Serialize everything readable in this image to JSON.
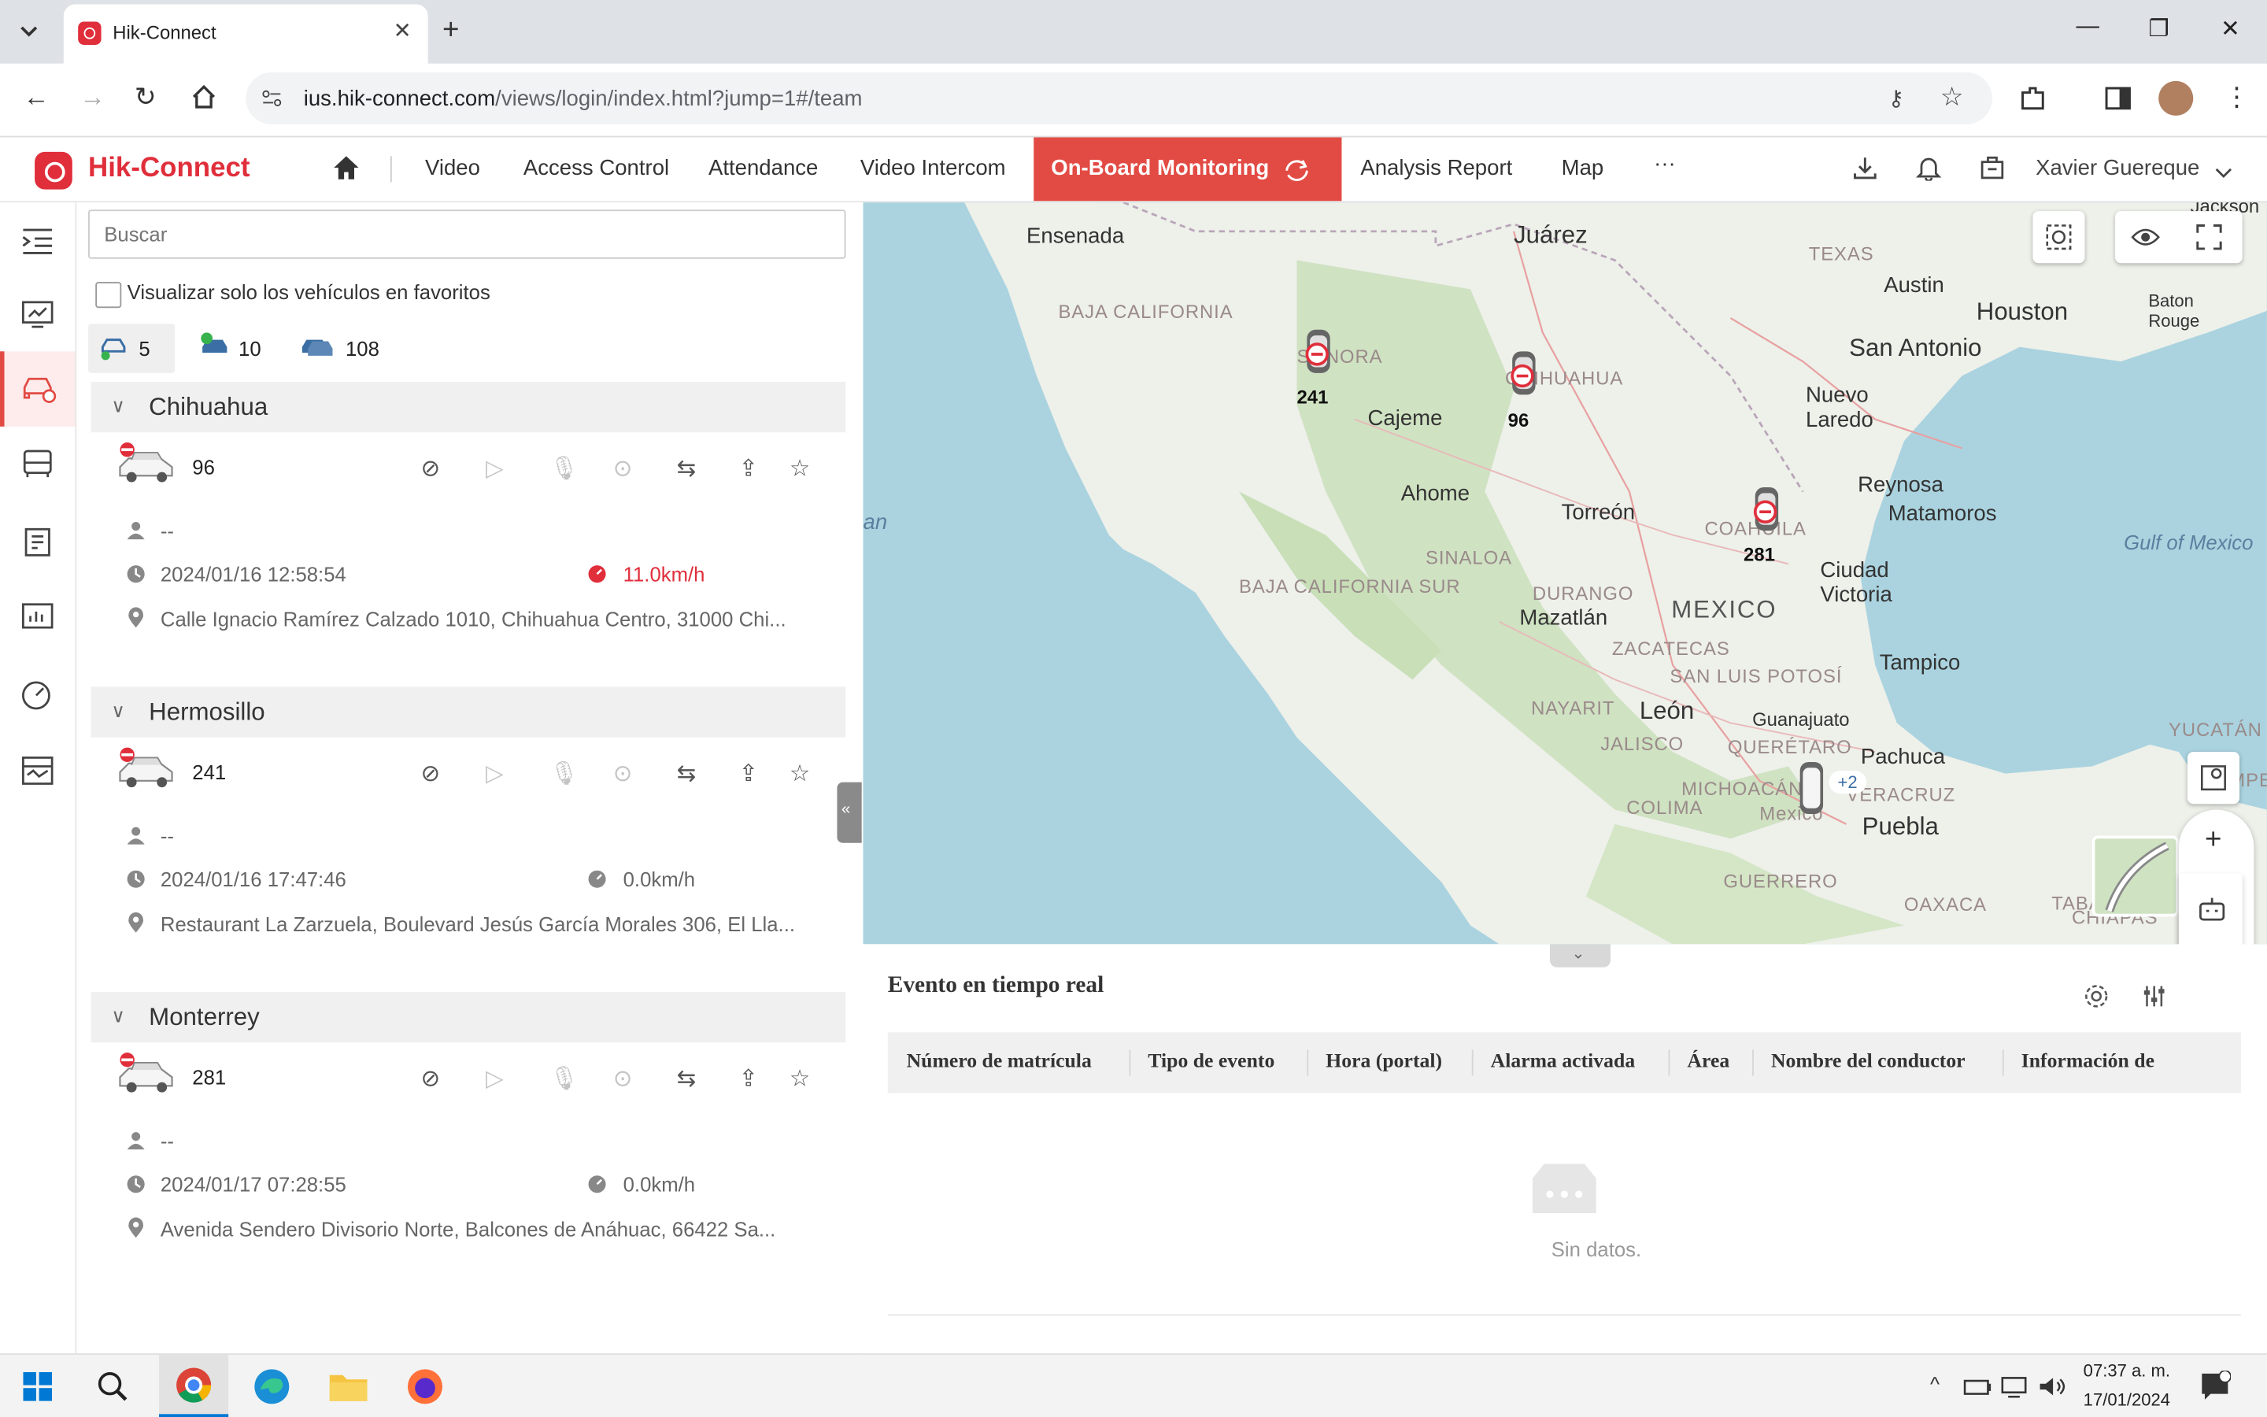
{
  "browser": {
    "tab_title": "Hik-Connect",
    "url_host": "ius.hik-connect.com",
    "url_path": "/views/login/index.html?jump=1#/team"
  },
  "app": {
    "brand": "Hik-Connect",
    "nav": [
      "Video",
      "Access Control",
      "Attendance",
      "Video Intercom",
      "On-Board Monitoring",
      "Analysis Report",
      "Map",
      "···"
    ],
    "user": "Xavier Guereque"
  },
  "panel": {
    "search_placeholder": "Buscar",
    "favorites_label": "Visualizar solo los vehículos en favoritos",
    "counts": {
      "online": "5",
      "available": "10",
      "total": "108"
    },
    "groups": [
      {
        "name": "Chihuahua",
        "vehicle": "96",
        "driver": "--",
        "time": "2024/01/16 12:58:54",
        "speed": "11.0km/h",
        "speed_alert": true,
        "address": "Calle Ignacio Ramírez Calzado 1010, Chihuahua Centro, 31000 Chi..."
      },
      {
        "name": "Hermosillo",
        "vehicle": "241",
        "driver": "--",
        "time": "2024/01/16 17:47:46",
        "speed": "0.0km/h",
        "speed_alert": false,
        "address": "Restaurant La Zarzuela, Boulevard Jesús García Morales 306, El Lla..."
      },
      {
        "name": "Monterrey",
        "vehicle": "281",
        "driver": "--",
        "time": "2024/01/17 07:28:55",
        "speed": "0.0km/h",
        "speed_alert": false,
        "address": "Avenida Sendero Divisorio Norte, Balcones de Anáhuac, 66422 Sa..."
      }
    ]
  },
  "map": {
    "cities": [
      "Ensenada",
      "Juárez",
      "Austin",
      "Houston",
      "San Antonio",
      "Baton Rouge",
      "Jackson",
      "Cajeme",
      "Nuevo Laredo",
      "Ahome",
      "Torreón",
      "Reynosa",
      "Matamoros",
      "Ciudad Victoria",
      "Mazatlán",
      "MEXICO",
      "León",
      "Guanajuato",
      "Tampico",
      "Pachuca",
      "Puebla",
      "Mexico"
    ],
    "states": [
      "BAJA CALIFORNIA",
      "TEXAS",
      "SONORA",
      "CHIHUAHUA",
      "COAHUILA",
      "SINALOA",
      "BAJA CALIFORNIA SUR",
      "DURANGO",
      "ZACATECAS",
      "SAN LUIS POTOSÍ",
      "NAYARIT",
      "JALISCO",
      "QUERÉTARO",
      "MICHOACÁN",
      "VERACRUZ",
      "COLIMA",
      "GUERRERO",
      "OAXACA",
      "YUCATÁN",
      "TABASCO",
      "CHIAPAS",
      "CAMPECHE"
    ],
    "seas": [
      "Gulf of Mexico",
      "an"
    ],
    "markers": [
      "241",
      "96",
      "281"
    ],
    "cluster": "+2"
  },
  "events": {
    "title": "Evento en tiempo real",
    "columns": [
      "Número de matrícula",
      "Tipo de evento",
      "Hora (portal)",
      "Alarma activada",
      "Área",
      "Nombre del conductor",
      "Información de"
    ],
    "empty": "Sin datos."
  },
  "taskbar": {
    "time": "07:37 a. m.",
    "date": "17/01/2024"
  }
}
